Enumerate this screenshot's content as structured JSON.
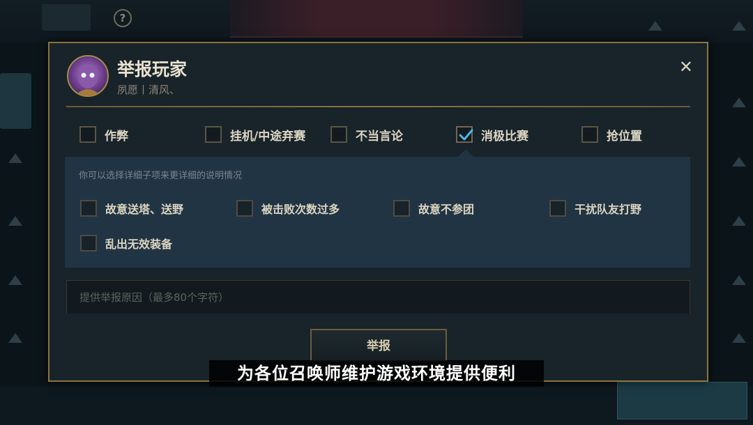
{
  "dialog": {
    "title": "举报玩家",
    "subtitle": "夙愿丨清风、",
    "close_icon": "close-icon",
    "categories": [
      {
        "label": "作弊",
        "checked": false
      },
      {
        "label": "挂机/中途弃赛",
        "checked": false
      },
      {
        "label": "不当言论",
        "checked": false
      },
      {
        "label": "消极比赛",
        "checked": true
      },
      {
        "label": "抢位置",
        "checked": false
      }
    ],
    "detail": {
      "hint": "你可以选择详细子项来更详细的说明情况",
      "options": [
        {
          "label": "故意送塔、送野",
          "checked": false
        },
        {
          "label": "被击败次数过多",
          "checked": false
        },
        {
          "label": "故意不参团",
          "checked": false
        },
        {
          "label": "干扰队友打野",
          "checked": false
        },
        {
          "label": "乱出无效装备",
          "checked": false
        }
      ]
    },
    "reason_placeholder": "提供举报原因（最多80个字符）",
    "reason_value": "",
    "submit_label": "举报"
  },
  "caption": "为各位召唤师维护游戏环境提供便利",
  "colors": {
    "accent_gold": "#8b7443",
    "panel_bg": "#18232a",
    "detail_bg": "#213443",
    "check_blue": "#4fb6e8"
  }
}
